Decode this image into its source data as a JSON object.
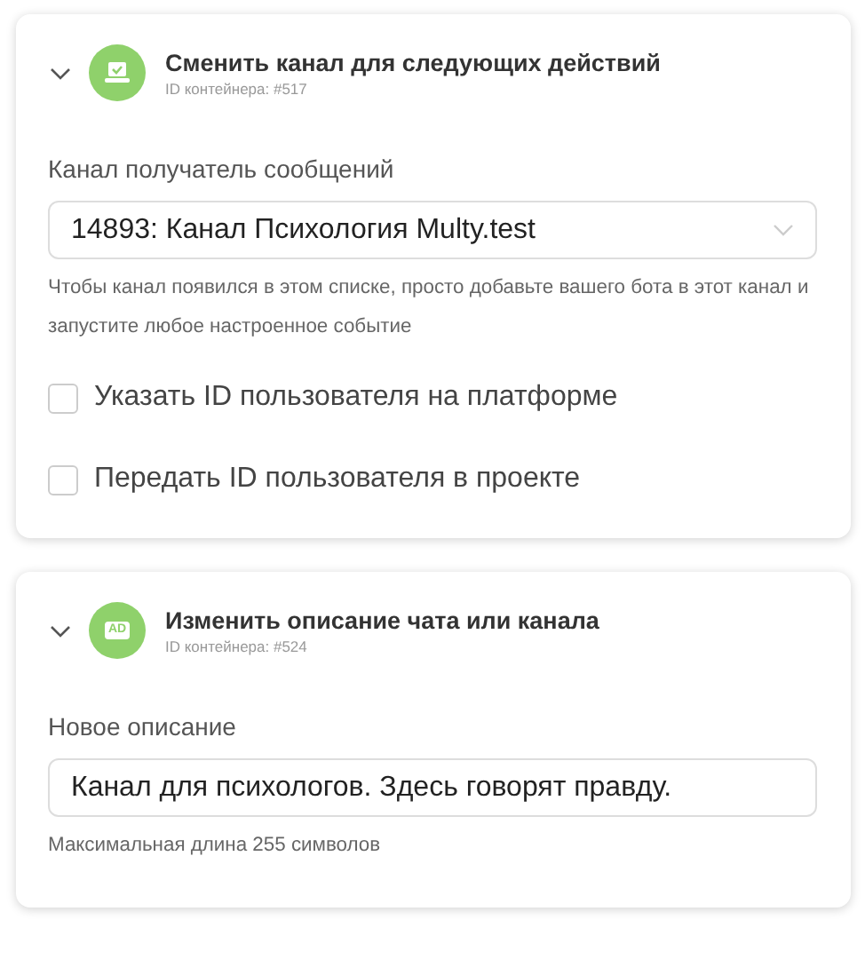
{
  "cards": [
    {
      "expanded": true,
      "icon": {
        "kind": "laptop"
      },
      "title": "Сменить канал для следующих действий",
      "container_id": "ID контейнера: #517",
      "label": "Канал получатель сообщений",
      "field": {
        "kind": "select",
        "value": "14893: Канал Психология Multy.test"
      },
      "hint": "Чтобы канал появился в этом списке, просто добавьте вашего бота в этот канал и запустите любое настроенное событие",
      "checkboxes": [
        {
          "label": "Указать ID пользователя на платформе",
          "checked": false
        },
        {
          "label": "Передать ID пользователя в проекте",
          "checked": false
        }
      ]
    },
    {
      "expanded": true,
      "icon": {
        "kind": "badge",
        "text": "AD"
      },
      "title": "Изменить описание чата или канала",
      "container_id": "ID контейнера: #524",
      "label": "Новое описание",
      "field": {
        "kind": "text",
        "value": "Канал для психологов. Здесь говорят правду."
      },
      "hint": "Максимальная длина 255 символов"
    }
  ]
}
